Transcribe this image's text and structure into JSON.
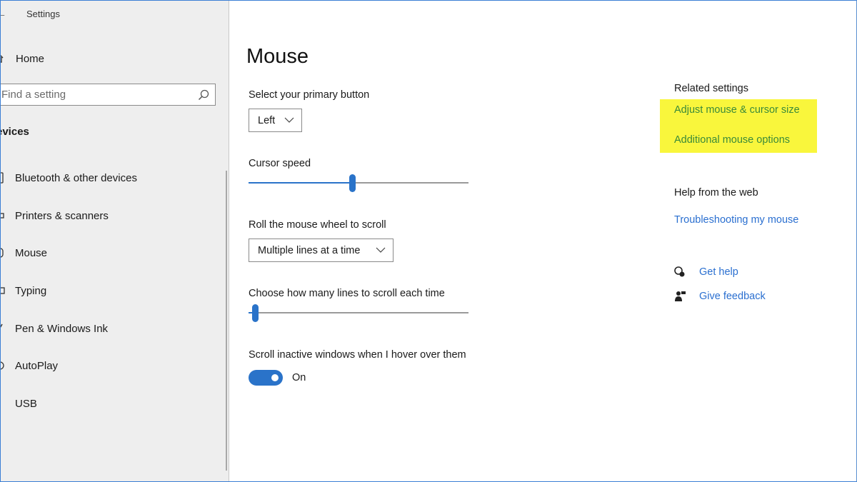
{
  "window": {
    "app_title": "Settings"
  },
  "sidebar": {
    "home_label": "Home",
    "search_placeholder": "Find a setting",
    "section_title": "evices",
    "items": [
      {
        "label": "Bluetooth & other devices",
        "icon": "bluetooth-icon"
      },
      {
        "label": "Printers & scanners",
        "icon": "printer-icon"
      },
      {
        "label": "Mouse",
        "icon": "mouse-icon",
        "selected": true
      },
      {
        "label": "Typing",
        "icon": "keyboard-icon"
      },
      {
        "label": "Pen & Windows Ink",
        "icon": "pen-icon"
      },
      {
        "label": "AutoPlay",
        "icon": "autoplay-icon"
      },
      {
        "label": "USB",
        "icon": "usb-icon"
      }
    ]
  },
  "main": {
    "title": "Mouse",
    "primary_button": {
      "label": "Select your primary button",
      "value": "Left"
    },
    "cursor_speed": {
      "label": "Cursor speed",
      "level": 0.47
    },
    "wheel_scroll": {
      "label": "Roll the mouse wheel to scroll",
      "value": "Multiple lines at a time"
    },
    "lines_to_scroll": {
      "label": "Choose how many lines to scroll each time",
      "level": 0.03
    },
    "inactive_scroll": {
      "label": "Scroll inactive windows when I hover over them",
      "state": "On"
    }
  },
  "related": {
    "title": "Related settings",
    "links": [
      "Adjust mouse & cursor size",
      "Additional mouse options"
    ],
    "highlight_color": "#f9f63c"
  },
  "help": {
    "title": "Help from the web",
    "troubleshoot_link": "Troubleshooting my mouse",
    "get_help": "Get help",
    "give_feedback": "Give feedback"
  },
  "colors": {
    "accent": "#2a73c9",
    "link": "#2a6fd0",
    "sidebar_bg": "#eeeeee"
  }
}
